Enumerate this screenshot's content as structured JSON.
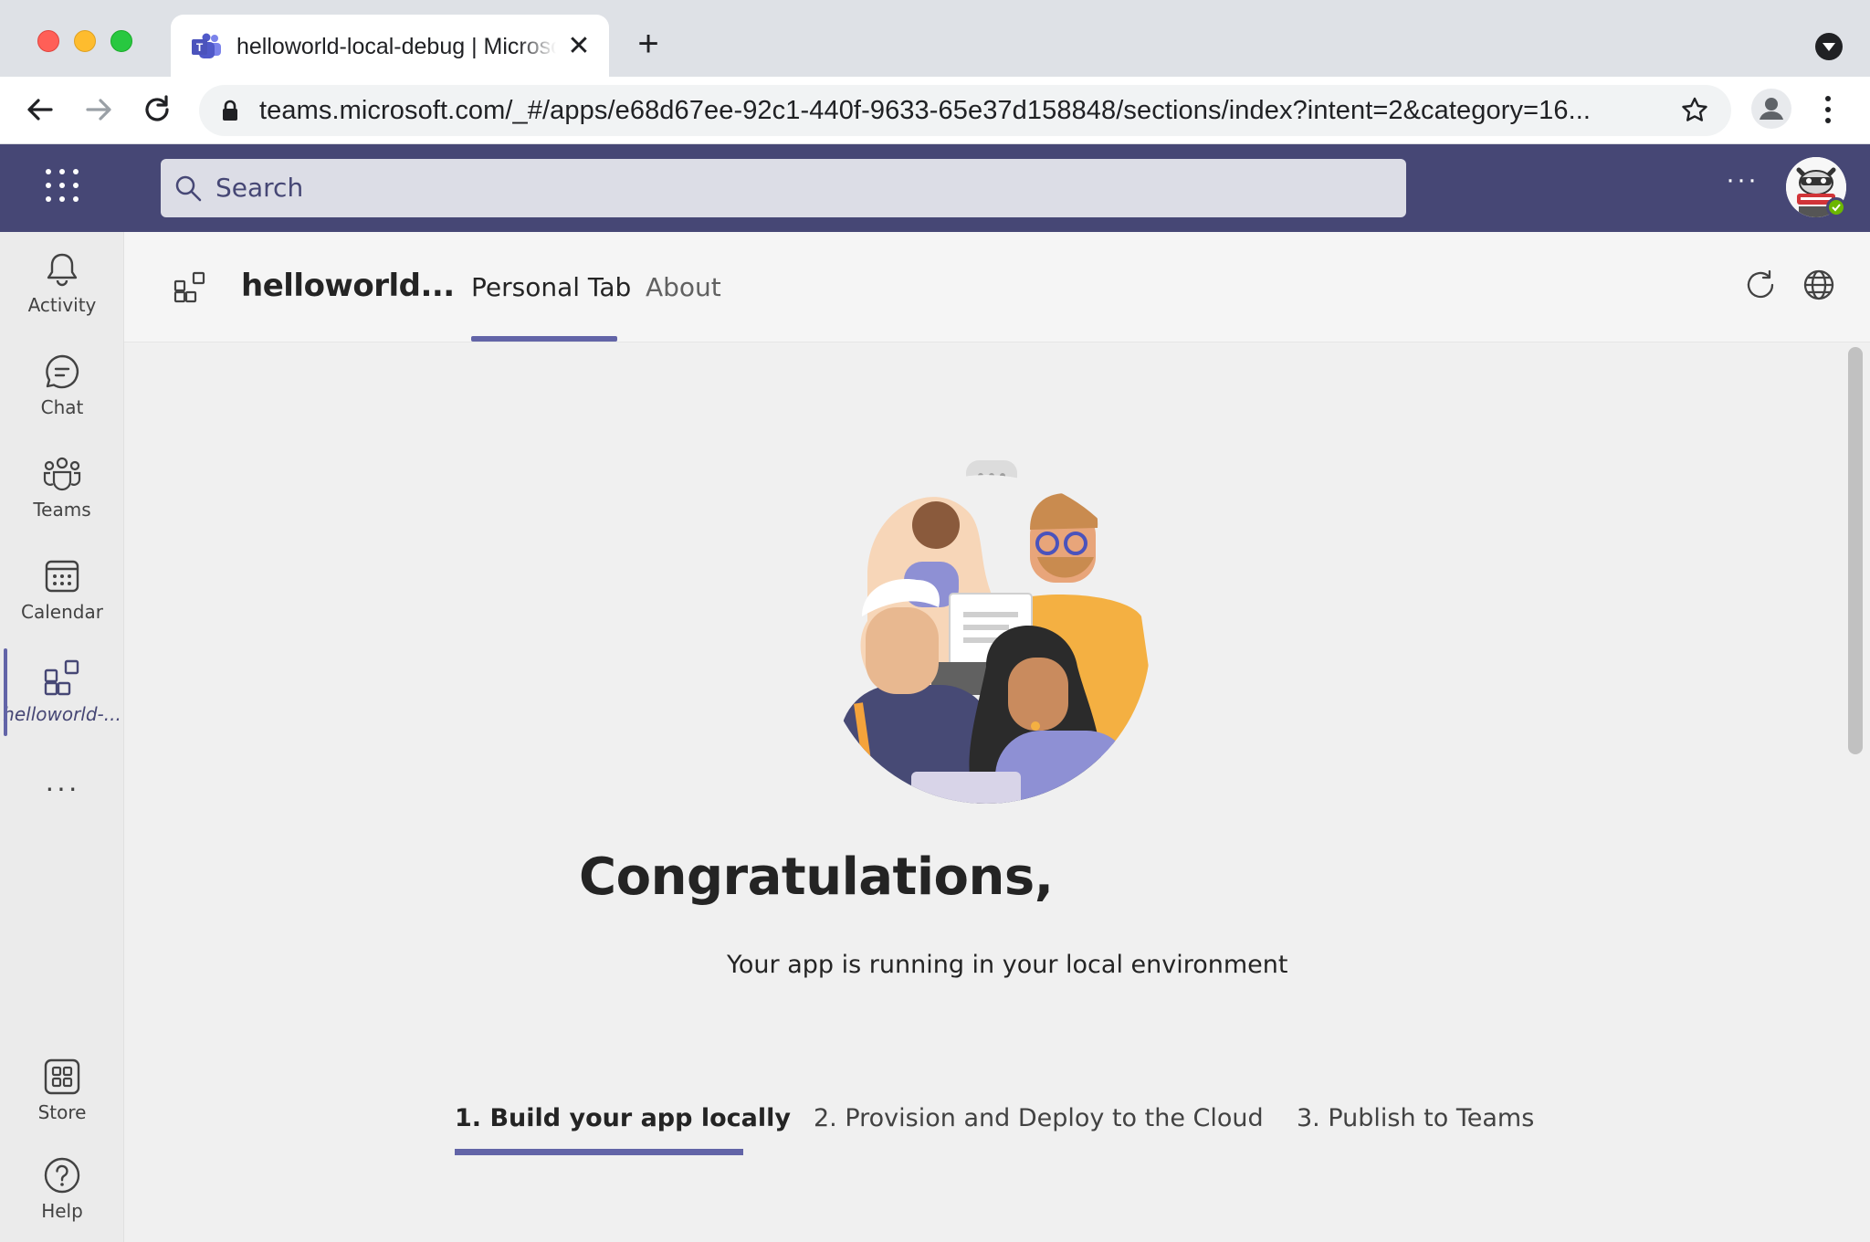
{
  "browser": {
    "tab_title": "helloworld-local-debug | Microsoft Teams",
    "new_tab_symbol": "+",
    "close_symbol": "✕",
    "url": "teams.microsoft.com/_#/apps/e68d67ee-92c1-440f-9633-65e37d158848/sections/index?intent=2&category=16..."
  },
  "teams": {
    "search_placeholder": "Search",
    "more_label": "···"
  },
  "rail": {
    "items": [
      {
        "label": "Activity",
        "icon": "bell-icon"
      },
      {
        "label": "Chat",
        "icon": "chat-icon"
      },
      {
        "label": "Teams",
        "icon": "teams-icon"
      },
      {
        "label": "Calendar",
        "icon": "calendar-icon"
      },
      {
        "label": "helloworld-...",
        "icon": "apps-icon",
        "active": true
      }
    ],
    "more_label": "···",
    "bottom": [
      {
        "label": "Store",
        "icon": "store-icon"
      },
      {
        "label": "Help",
        "icon": "help-icon"
      }
    ]
  },
  "app": {
    "name": "helloworld...",
    "tabs": [
      {
        "label": "Personal Tab",
        "active": true
      },
      {
        "label": "About",
        "active": false
      }
    ]
  },
  "main": {
    "heading": "Congratulations,",
    "subtitle": "Your app is running in your local environment",
    "steps": [
      {
        "label": "1. Build your app locally",
        "active": true
      },
      {
        "label": "2. Provision and Deploy to the Cloud",
        "active": false
      },
      {
        "label": "3. Publish to Teams",
        "active": false
      }
    ]
  },
  "colors": {
    "teams_purple": "#464775",
    "accent": "#6264a7",
    "content_bg": "#f0f0f0"
  }
}
